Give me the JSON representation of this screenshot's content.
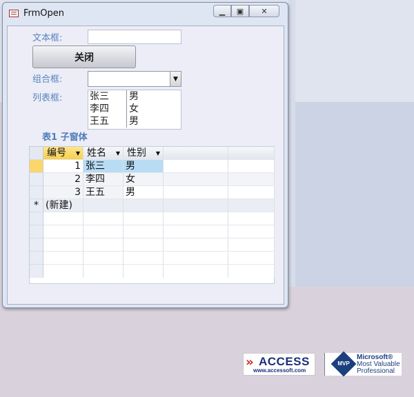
{
  "window": {
    "title": "FrmOpen",
    "controls": {
      "minimize": "▁",
      "maximize": "▣",
      "close": "✕"
    }
  },
  "form": {
    "textbox_label": "文本框:",
    "textbox_value": "",
    "close_button_label": "关闭",
    "combo_label": "组合框:",
    "combo_value": "",
    "listbox_label": "列表框:",
    "listbox_rows": [
      {
        "name": "张三",
        "gender": "男"
      },
      {
        "name": "李四",
        "gender": "女"
      },
      {
        "name": "王五",
        "gender": "男"
      }
    ],
    "subform_title": "表1  子窗体"
  },
  "datasheet": {
    "columns": [
      "编号",
      "姓名",
      "性别"
    ],
    "rows": [
      {
        "id": "1",
        "name": "张三",
        "gender": "男"
      },
      {
        "id": "2",
        "name": "李四",
        "gender": "女"
      },
      {
        "id": "3",
        "name": "王五",
        "gender": "男"
      }
    ],
    "new_row_label": "(新建)",
    "new_row_marker": "*"
  },
  "logos": {
    "access_text": "ACCESS",
    "access_url": "www.accessoft.com",
    "mvp_badge": "MVP",
    "mvp_line1": "Microsoft®",
    "mvp_line2": "Most Valuable",
    "mvp_line3": "Professional"
  }
}
